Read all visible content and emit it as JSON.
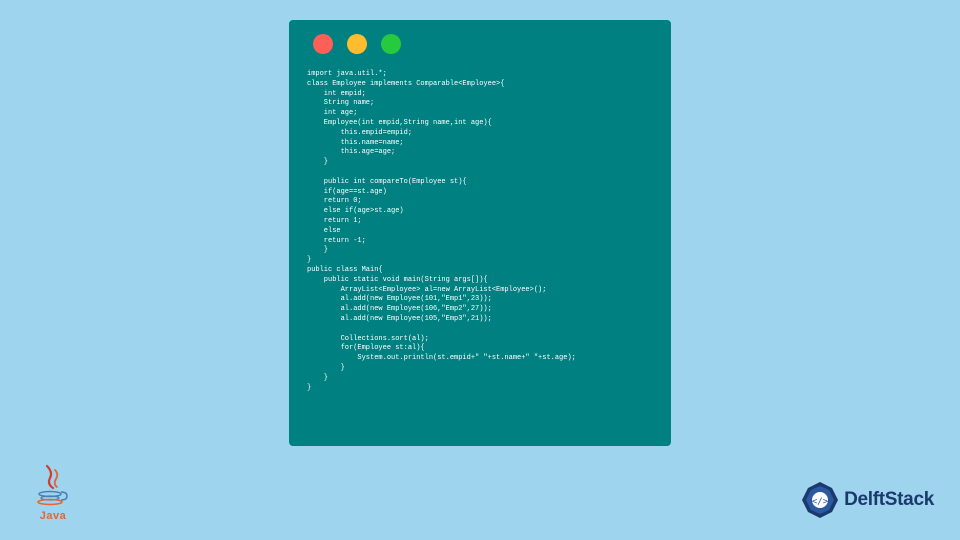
{
  "code_window": {
    "code": "import java.util.*;\nclass Employee implements Comparable<Employee>{\n    int empid;\n    String name;\n    int age;\n    Employee(int empid,String name,int age){\n        this.empid=empid;\n        this.name=name;\n        this.age=age;\n    }\n\n    public int compareTo(Employee st){\n    if(age==st.age)\n    return 0;\n    else if(age>st.age)\n    return 1;\n    else\n    return -1;\n    }\n}\npublic class Main{\n    public static void main(String args[]){\n        ArrayList<Employee> al=new ArrayList<Employee>();\n        al.add(new Employee(101,\"Emp1\",23));\n        al.add(new Employee(106,\"Emp2\",27));\n        al.add(new Employee(105,\"Emp3\",21));\n\n        Collections.sort(al);\n        for(Employee st:al){\n            System.out.println(st.empid+\" \"+st.name+\" \"+st.age);\n        }\n    }\n}"
  },
  "java_logo": {
    "text": "Java"
  },
  "delft_logo": {
    "text": "DelftStack"
  }
}
